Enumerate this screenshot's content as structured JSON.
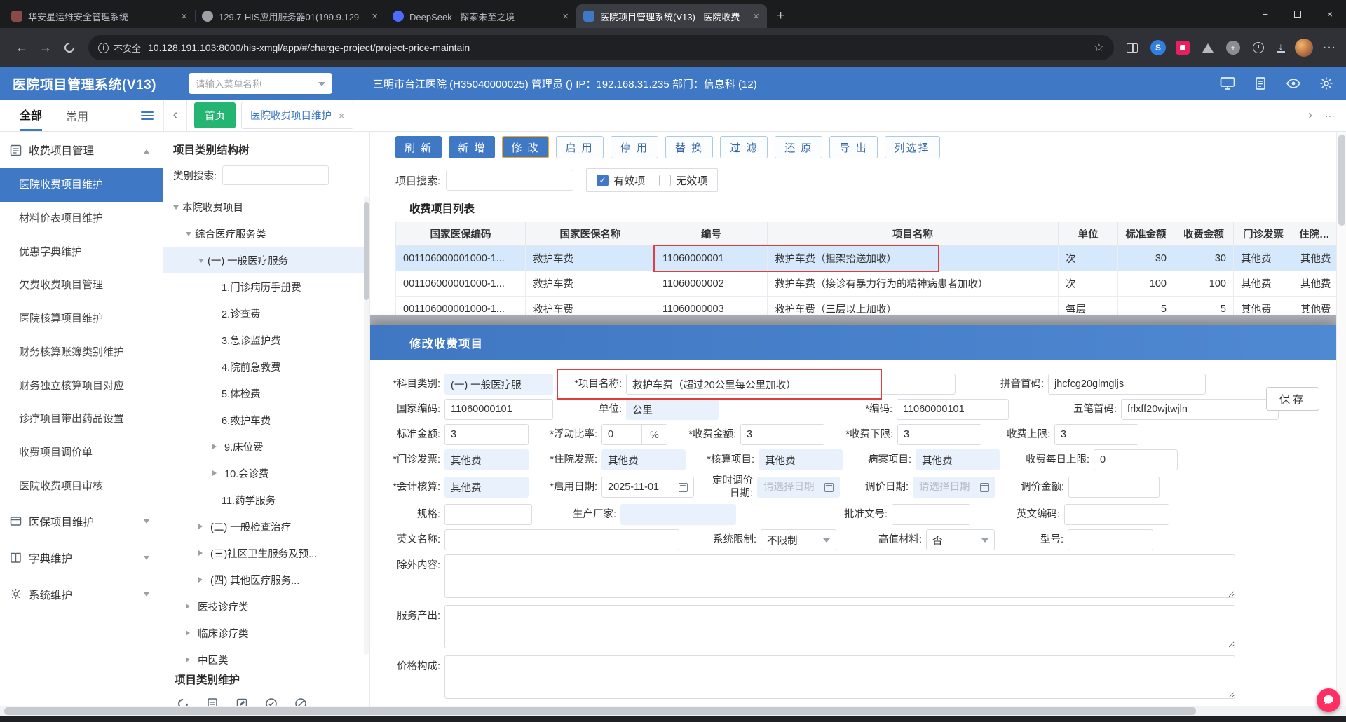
{
  "icons": {
    "back": "←",
    "forward": "→",
    "close": "×",
    "new_tab": "+",
    "minimize": "−",
    "star": "☆",
    "more": "···",
    "check": "✓",
    "chevron_left": "‹",
    "chevron_right": "›",
    "info": "i",
    "ext_badge": "S"
  },
  "colors": {
    "primary_blue": "#3f78c4",
    "green": "#23b571",
    "highlight_red": "#e03e3e",
    "input_blue": "#e8f1fc",
    "row_selected": "#d6e8fb"
  },
  "browser": {
    "tabs": [
      {
        "title": "华安星运维安全管理系统"
      },
      {
        "title": "129.7-HIS应用服务器01(199.9.129"
      },
      {
        "title": "DeepSeek - 探索未至之境"
      },
      {
        "title": "医院项目管理系统(V13) - 医院收费"
      }
    ],
    "address": {
      "security_label": "不安全",
      "url": "10.128.191.103:8000/his-xmgl/app/#/charge-project/project-price-maintain"
    }
  },
  "app_header": {
    "title": "医院项目管理系统(V13)",
    "menu_search_placeholder": "请输入菜单名称",
    "user_info": "三明市台江医院 (H35040000025) 管理员 () IP：192.168.31.235 部门：信息科 (12)"
  },
  "nav_tabs": {
    "filters": [
      {
        "label": "全部"
      },
      {
        "label": "常用"
      }
    ],
    "pages": [
      {
        "label": "首页"
      },
      {
        "label": "医院收费项目维护"
      }
    ]
  },
  "sidebar": {
    "sections": [
      {
        "label": "收费项目管理",
        "items": [
          {
            "label": "医院收费项目维护"
          },
          {
            "label": "材料价表项目维护"
          },
          {
            "label": "优惠字典维护"
          },
          {
            "label": "欠费收费项目管理"
          },
          {
            "label": "医院核算项目维护"
          },
          {
            "label": "财务核算账簿类别维护"
          },
          {
            "label": "财务独立核算项目对应"
          },
          {
            "label": "诊疗项目带出药品设置"
          },
          {
            "label": "收费项目调价单"
          },
          {
            "label": "医院收费项目审核"
          }
        ]
      },
      {
        "label": "医保项目维护"
      },
      {
        "label": "字典维护"
      },
      {
        "label": "系统维护"
      }
    ]
  },
  "tree_panel": {
    "title": "项目类别结构树",
    "search_label": "类别搜索:",
    "footer_title": "项目类别维护",
    "nodes": [
      {
        "label": "本院收费项目"
      },
      {
        "label": "综合医疗服务类"
      },
      {
        "label": "(一) 一般医疗服务"
      },
      {
        "label": "1.门诊病历手册费"
      },
      {
        "label": "2.诊查费"
      },
      {
        "label": "3.急诊监护费"
      },
      {
        "label": "4.院前急救费"
      },
      {
        "label": "5.体检费"
      },
      {
        "label": "6.救护车费"
      },
      {
        "label": "9.床位费"
      },
      {
        "label": "10.会诊费"
      },
      {
        "label": "11.药学服务"
      },
      {
        "label": "(二) 一般检查治疗"
      },
      {
        "label": "(三)社区卫生服务及预..."
      },
      {
        "label": "(四) 其他医疗服务..."
      },
      {
        "label": "医技诊疗类"
      },
      {
        "label": "临床诊疗类"
      },
      {
        "label": "中医类"
      }
    ]
  },
  "toolbar": {
    "buttons": [
      {
        "label": "刷 新"
      },
      {
        "label": "新 增"
      },
      {
        "label": "修 改"
      },
      {
        "label": "启 用"
      },
      {
        "label": "停 用"
      },
      {
        "label": "替 换"
      },
      {
        "label": "过 滤"
      },
      {
        "label": "还 原"
      },
      {
        "label": "导 出"
      },
      {
        "label": "列选择"
      }
    ],
    "search_label": "项目搜索:",
    "valid_label": "有效项",
    "invalid_label": "无效项"
  },
  "table": {
    "title": "收费项目列表",
    "columns": [
      "国家医保编码",
      "国家医保名称",
      "编号",
      "项目名称",
      "单位",
      "标准金额",
      "收费金额",
      "门诊发票",
      "住院发票"
    ],
    "rows": [
      [
        "001106000001000-1...",
        "救护车费",
        "11060000001",
        "救护车费（担架抬送加收）",
        "次",
        "30",
        "30",
        "其他费",
        "其他费"
      ],
      [
        "001106000001000-1...",
        "救护车费",
        "11060000002",
        "救护车费（接诊有暴力行为的精神病患者加收）",
        "次",
        "100",
        "100",
        "其他费",
        "其他费"
      ],
      [
        "001106000001000-1...",
        "救护车费",
        "11060000003",
        "救护车费（三层以上加收）",
        "每层",
        "5",
        "5",
        "其他费",
        "其他费"
      ]
    ]
  },
  "modal": {
    "title": "修改收费项目",
    "save_label": "保存",
    "fields": {
      "subject_category": {
        "label": "*科目类别:",
        "value": "(一) 一般医疗服"
      },
      "project_name": {
        "label": "*项目名称:",
        "value": "救护车费（超过20公里每公里加收）"
      },
      "pinyin_code": {
        "label": "拼音首码:",
        "value": "jhcfcg20glmgljs"
      },
      "national_code": {
        "label": "国家编码:",
        "value": "11060000101"
      },
      "unit": {
        "label": "单位:",
        "value": "公里"
      },
      "code": {
        "label": "*编码:",
        "value": "11060000101"
      },
      "wubi_code": {
        "label": "五笔首码:",
        "value": "frlxff20wjtwjln"
      },
      "standard_amount": {
        "label": "标准金额:",
        "value": "3"
      },
      "float_ratio": {
        "label": "*浮动比率:",
        "value": "0",
        "suffix": "%"
      },
      "charge_amount": {
        "label": "*收费金额:",
        "value": "3"
      },
      "charge_lower": {
        "label": "*收费下限:",
        "value": "3"
      },
      "charge_upper": {
        "label": "收费上限:",
        "value": "3"
      },
      "outpatient_invoice": {
        "label": "*门诊发票:",
        "value": "其他费"
      },
      "inpatient_invoice": {
        "label": "*住院发票:",
        "value": "其他费"
      },
      "accounting_item": {
        "label": "*核算项目:",
        "value": "其他费"
      },
      "medical_record_item": {
        "label": "病案项目:",
        "value": "其他费"
      },
      "daily_limit": {
        "label": "收费每日上限:",
        "value": "0"
      },
      "fiscal_accounting": {
        "label": "*会计核算:",
        "value": "其他费"
      },
      "enable_date": {
        "label": "*启用日期:",
        "value": "2025-11-01"
      },
      "scheduled_price_date": {
        "label": "定时调价日期:",
        "placeholder": "请选择日期"
      },
      "adjust_date": {
        "label": "调价日期:",
        "placeholder": "请选择日期"
      },
      "adjust_amount": {
        "label": "调价金额:",
        "value": ""
      },
      "spec": {
        "label": "规格:",
        "value": ""
      },
      "manufacturer": {
        "label": "生产厂家:",
        "value": ""
      },
      "approval_number": {
        "label": "批准文号:",
        "value": ""
      },
      "english_code": {
        "label": "英文编码:",
        "value": ""
      },
      "english_name": {
        "label": "英文名称:",
        "value": ""
      },
      "system_limit": {
        "label": "系统限制:",
        "value": "不限制"
      },
      "high_value_material": {
        "label": "高值材料:",
        "value": "否"
      },
      "model": {
        "label": "型号:",
        "value": ""
      },
      "exclusion": {
        "label": "除外内容:"
      },
      "service_output": {
        "label": "服务产出:"
      },
      "price_composition": {
        "label": "价格构成:"
      }
    }
  }
}
